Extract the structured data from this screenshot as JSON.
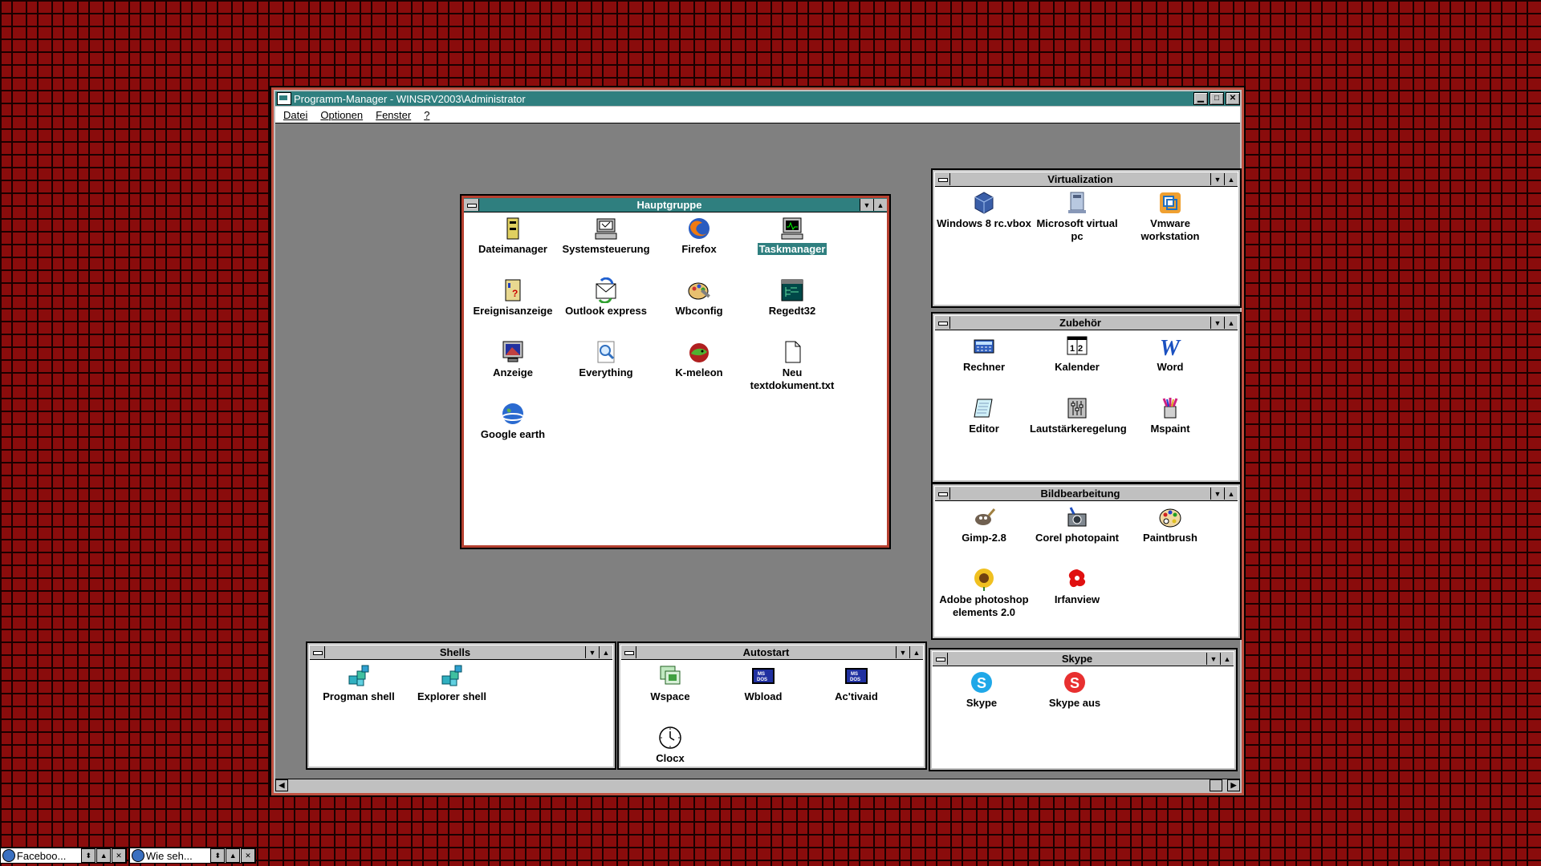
{
  "main_window": {
    "title": "Programm-Manager - WINSRV2003\\Administrator",
    "menu": [
      "Datei",
      "Optionen",
      "Fenster",
      "?"
    ]
  },
  "groups": {
    "hauptgruppe": {
      "title": "Hauptgruppe",
      "items": [
        "Dateimanager",
        "Systemsteuerung",
        "Firefox",
        "Taskmanager",
        "Ereignisanzeige",
        "Outlook express",
        "Wbconfig",
        "Regedt32",
        "Anzeige",
        "Everything",
        "K-meleon",
        "Neu textdokument.txt",
        "Google earth"
      ],
      "selected": "Taskmanager"
    },
    "virtualization": {
      "title": "Virtualization",
      "items": [
        "Windows 8 rc.vbox",
        "Microsoft virtual pc",
        "Vmware workstation"
      ]
    },
    "zubehoer": {
      "title": "Zubehör",
      "items": [
        "Rechner",
        "Kalender",
        "Word",
        "Editor",
        "Lautstärkeregelung",
        "Mspaint"
      ]
    },
    "bildbearbeitung": {
      "title": "Bildbearbeitung",
      "items": [
        "Gimp-2.8",
        "Corel photopaint",
        "Paintbrush",
        "Adobe photoshop elements 2.0",
        "Irfanview"
      ]
    },
    "skype": {
      "title": "Skype",
      "items": [
        "Skype",
        "Skype aus"
      ]
    },
    "shells": {
      "title": "Shells",
      "items": [
        "Progman shell",
        "Explorer shell"
      ]
    },
    "autostart": {
      "title": "Autostart",
      "items": [
        "Wspace",
        "Wbload",
        "Ac'tivaid",
        "Clocx"
      ]
    }
  },
  "taskbar": [
    "Faceboo...",
    "Wie seh..."
  ],
  "colors": {
    "titlebar": "#2f7f7f",
    "workspace": "#808080",
    "desktop": "#8a0c0c"
  }
}
